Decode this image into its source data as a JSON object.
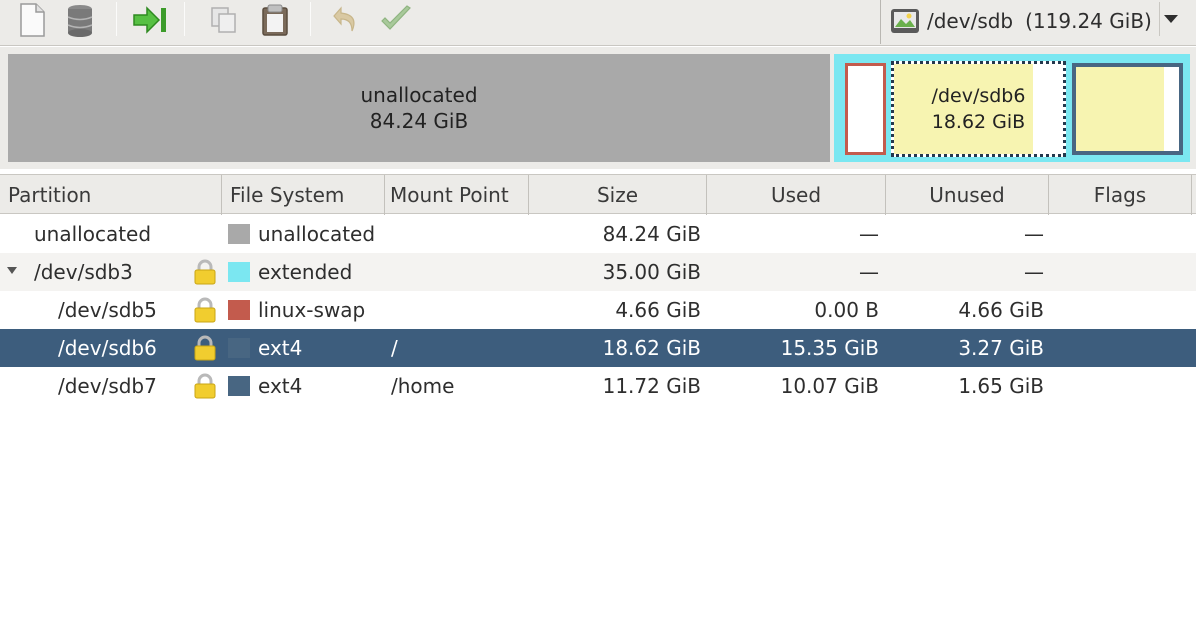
{
  "device": {
    "name": "/dev/sdb",
    "size": "(119.24 GiB)"
  },
  "toolbar": {
    "icons": [
      "new-icon",
      "delete-icon",
      "resize-move-icon",
      "copy-icon",
      "paste-icon",
      "undo-icon",
      "apply-icon"
    ]
  },
  "disk_map": {
    "unallocated": {
      "label": "unallocated",
      "size": "84.24 GiB"
    },
    "sdb6": {
      "label": "/dev/sdb6",
      "size": "18.62 GiB",
      "used_fraction": 0.824
    },
    "sdb7": {
      "used_fraction": 0.859
    },
    "colors": {
      "unallocated": "#a9a9a9",
      "extended": "#7be7f1",
      "linux_swap": "#c35b4d",
      "ext4": "#486682",
      "used": "#f7f4b1"
    }
  },
  "table": {
    "headers": {
      "partition": "Partition",
      "filesystem": "File System",
      "mount": "Mount Point",
      "size": "Size",
      "used": "Used",
      "unused": "Unused",
      "flags": "Flags"
    },
    "rows": [
      {
        "partition": "unallocated",
        "fs": "unallocated",
        "mount": "",
        "size": "84.24 GiB",
        "used": "—",
        "unused": "—",
        "flags": "",
        "color": "#a9a9a9",
        "locked": false,
        "indent": 0,
        "expander": false
      },
      {
        "partition": "/dev/sdb3",
        "fs": "extended",
        "mount": "",
        "size": "35.00 GiB",
        "used": "—",
        "unused": "—",
        "flags": "",
        "color": "#7be7f1",
        "locked": true,
        "indent": 0,
        "expander": true
      },
      {
        "partition": "/dev/sdb5",
        "fs": "linux-swap",
        "mount": "",
        "size": "4.66 GiB",
        "used": "0.00 B",
        "unused": "4.66 GiB",
        "flags": "",
        "color": "#c35b4d",
        "locked": true,
        "indent": 1,
        "expander": false
      },
      {
        "partition": "/dev/sdb6",
        "fs": "ext4",
        "mount": "/",
        "size": "18.62 GiB",
        "used": "15.35 GiB",
        "unused": "3.27 GiB",
        "flags": "",
        "color": "#486682",
        "locked": true,
        "indent": 1,
        "expander": false,
        "selected": true
      },
      {
        "partition": "/dev/sdb7",
        "fs": "ext4",
        "mount": "/home",
        "size": "11.72 GiB",
        "used": "10.07 GiB",
        "unused": "1.65 GiB",
        "flags": "",
        "color": "#486682",
        "locked": true,
        "indent": 1,
        "expander": false
      }
    ]
  }
}
